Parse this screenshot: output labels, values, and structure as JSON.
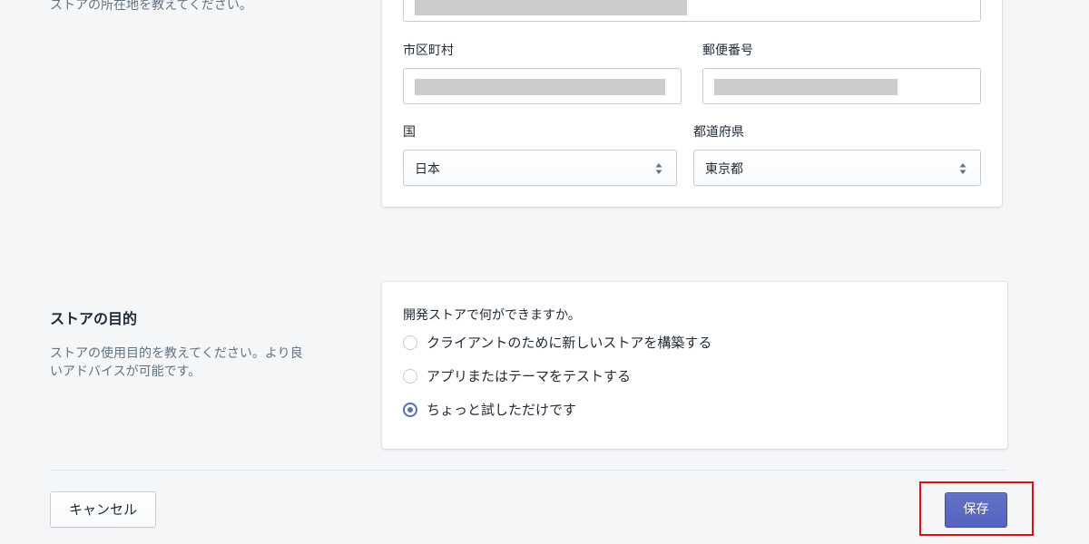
{
  "address_section": {
    "description": "ストアの所在地を教えてください。",
    "city_label": "市区町村",
    "postal_label": "郵便番号",
    "country_label": "国",
    "country_value": "日本",
    "prefecture_label": "都道府県",
    "prefecture_value": "東京都"
  },
  "purpose_section": {
    "title": "ストアの目的",
    "description_line1": "ストアの使用目的を教えてください。より良",
    "description_line2": "いアドバイスが可能です。",
    "question": "開発ストアで何ができますか。",
    "options": [
      {
        "label": "クライアントのために新しいストアを構築する",
        "checked": false
      },
      {
        "label": "アプリまたはテーマをテストする",
        "checked": false
      },
      {
        "label": "ちょっと試しただけです",
        "checked": true
      }
    ]
  },
  "footer": {
    "cancel_label": "キャンセル",
    "save_label": "保存"
  },
  "colors": {
    "accent": "#5c6ac4",
    "highlight": "#e01010",
    "background": "#f4f6f8"
  },
  "icons": {
    "select_arrow": "select-arrow-icon"
  }
}
